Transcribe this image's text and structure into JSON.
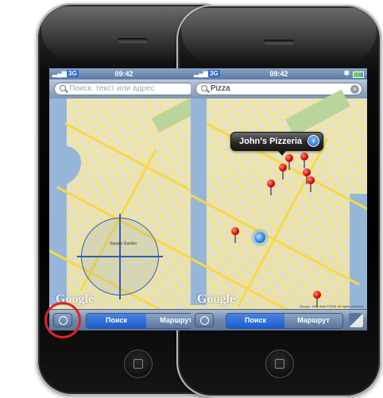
{
  "left_phone": {
    "status": {
      "network": "3G",
      "time": "09:42"
    },
    "search": {
      "placeholder": "Поиск: текст или адрес"
    },
    "map": {
      "logo": "Google",
      "label": "Square Garden"
    },
    "toolbar": {
      "search_label": "Поиск",
      "route_label": "Маршрут",
      "active": "search"
    }
  },
  "right_phone": {
    "status": {
      "network": "3G",
      "time": "09:42"
    },
    "search": {
      "value": "Pizza"
    },
    "callout": {
      "title": "John's Pizzeria"
    },
    "map": {
      "logo": "Google",
      "copyright": "Google - Map data ©2008. All rights reserved."
    },
    "toolbar": {
      "search_label": "Поиск",
      "route_label": "Маршрут",
      "active": "route"
    }
  },
  "colors": {
    "highlight_circle": "#e0202e",
    "active_segment": "#1d5ccc",
    "pin": "#d40000"
  },
  "icons": [
    "locate-icon",
    "search-icon",
    "clear-icon",
    "disclosure-icon",
    "pin-icon",
    "page-curl-icon",
    "home-button-icon"
  ]
}
